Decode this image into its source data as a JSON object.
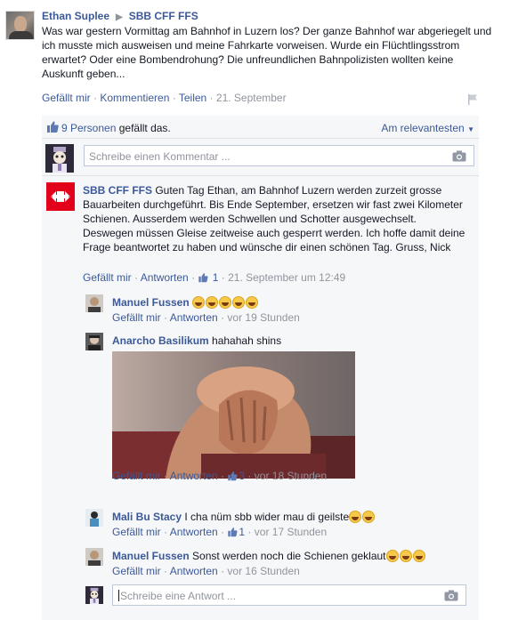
{
  "post": {
    "author": "Ethan Suplee",
    "target": "SBB CFF FFS",
    "text": "Was war gestern Vormittag am Bahnhof in Luzern los? Der ganze Bahnhof war abgeriegelt und ich musste mich ausweisen und meine Fahrkarte vorweisen. Wurde ein Flüchtlingsstrom erwartet? Oder eine Bombendrohung? Die unfreundlichen Bahnpolizisten wollten keine Auskunft geben...",
    "like_label": "Gefällt mir",
    "comment_label": "Kommentieren",
    "share_label": "Teilen",
    "date": "21. September",
    "flag_icon": "flag-icon"
  },
  "likes": {
    "count_text": "9 Personen",
    "suffix": " gefällt das.",
    "sort_label": "Am relevantesten"
  },
  "compose": {
    "placeholder": "Schreibe einen Kommentar ..."
  },
  "main_comment": {
    "author": "SBB CFF FFS",
    "text": " Guten Tag Ethan, am Bahnhof Luzern werden zurzeit grosse Bauarbeiten durchgeführt. Bis Ende September, ersetzen wir fast zwei Kilometer Schienen. Ausserdem werden Schwellen und Schotter ausgewechselt. Deswegen müssen Gleise zeitweise auch gesperrt werden. Ich hoffe damit deine Frage beantwortet zu haben und wünsche dir einen schönen Tag. Gruss, Nick",
    "like_label": "Gefällt mir",
    "reply_label": "Antworten",
    "likes": "1",
    "time": "21. September um 12:49"
  },
  "replies": [
    {
      "author": "Manuel Fussen",
      "text": " ",
      "emoji_count": 5,
      "like_label": "Gefällt mir",
      "reply_label": "Antworten",
      "likes": "",
      "time": "vor 19 Stunden"
    },
    {
      "author": "Anarcho Basilikum",
      "text": " hahahah shins",
      "emoji_count": 0,
      "like_label": "Gefällt mir",
      "reply_label": "Antworten",
      "likes": "3",
      "time": "vor 18 Stunden"
    },
    {
      "author": "Mali Bu Stacy",
      "text": " I cha nüm sbb wider mau di geilste",
      "emoji_count": 2,
      "like_label": "Gefällt mir",
      "reply_label": "Antworten",
      "likes": "1",
      "time": "vor 17 Stunden"
    },
    {
      "author": "Manuel Fussen",
      "text": " Sonst werden noch die Schienen geklaut",
      "emoji_count": 3,
      "like_label": "Gefällt mir",
      "reply_label": "Antworten",
      "likes": "",
      "time": "vor 16 Stunden"
    }
  ],
  "reply_compose": {
    "placeholder": "Schreibe eine Antwort ..."
  },
  "colors": {
    "link": "#3b5998",
    "sbb_red": "#e3001b",
    "muted": "#90949c"
  }
}
